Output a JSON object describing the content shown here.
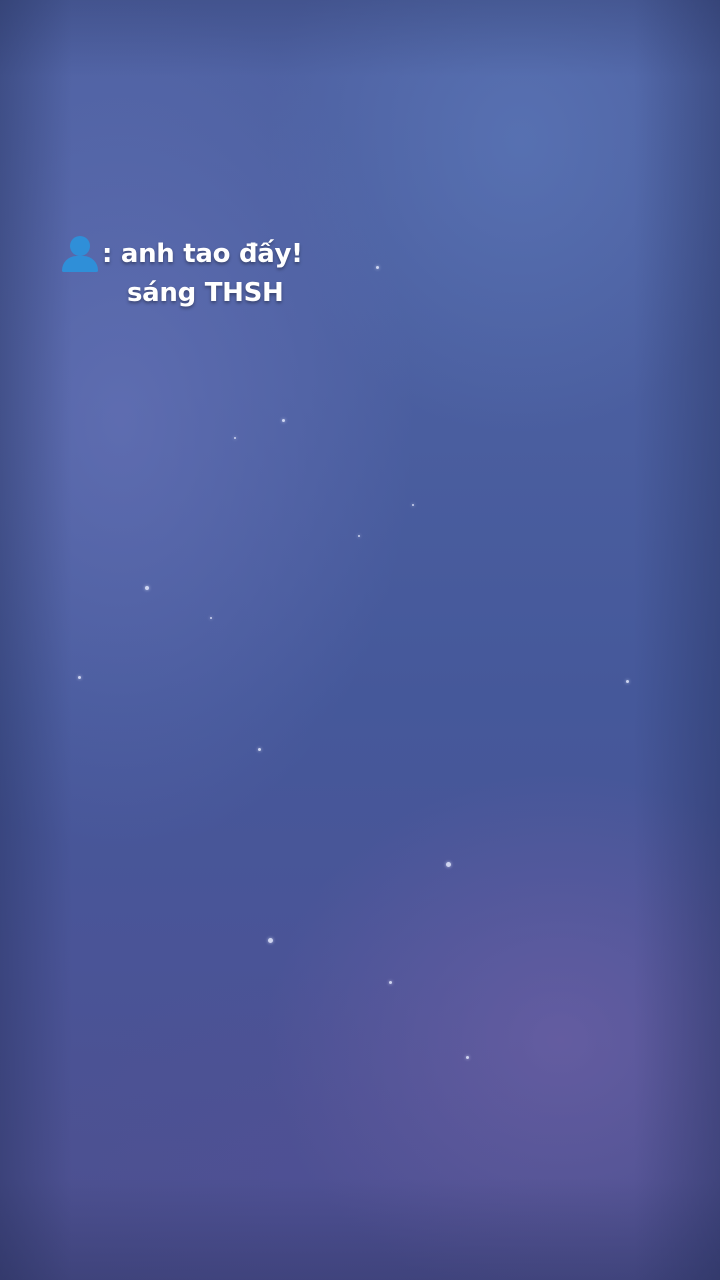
{
  "caption": {
    "icon": "person-silhouette-icon",
    "line1": ": anh tao đấy!",
    "line2": "sáng THSH"
  }
}
